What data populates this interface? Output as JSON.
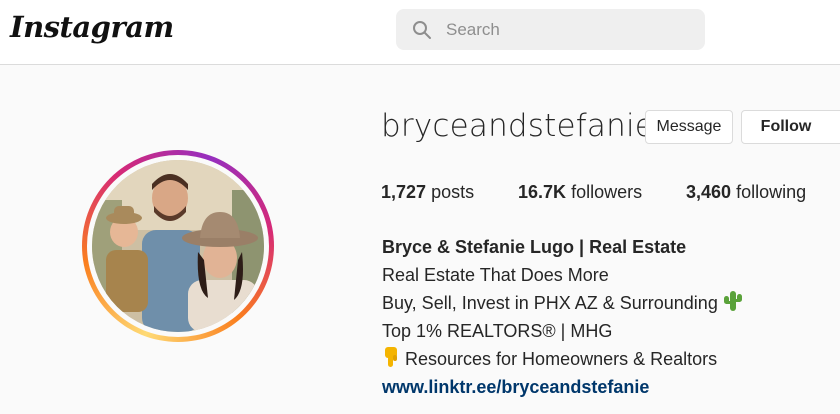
{
  "header": {
    "logo": "Instagram",
    "search": {
      "placeholder": "Search",
      "icon": "search-icon"
    }
  },
  "profile": {
    "username": "bryceandstefanie",
    "buttons": {
      "message": "Message",
      "follow": "Follow"
    },
    "stats": {
      "posts_count": "1,727",
      "posts_label": "posts",
      "followers_count": "16.7K",
      "followers_label": "followers",
      "following_count": "3,460",
      "following_label": "following"
    },
    "bio": {
      "name": "Bryce & Stefanie Lugo | Real Estate",
      "line1": "Real Estate That Does More",
      "line2": "Buy, Sell, Invest in PHX AZ & Surrounding",
      "line2_icon": "cactus-icon",
      "line3": "Top 1% REALTORS® | MHG",
      "line4": "Resources for Homeowners & Realtors",
      "line4_icon": "pointing-down-hand-icon",
      "link": "www.linktr.ee/bryceandstefanie"
    }
  },
  "colors": {
    "background": "#fafafa",
    "text": "#262626",
    "link": "#00376b",
    "story_ring": [
      "#feda75",
      "#fa7e1e",
      "#d62976",
      "#962fbf"
    ]
  }
}
